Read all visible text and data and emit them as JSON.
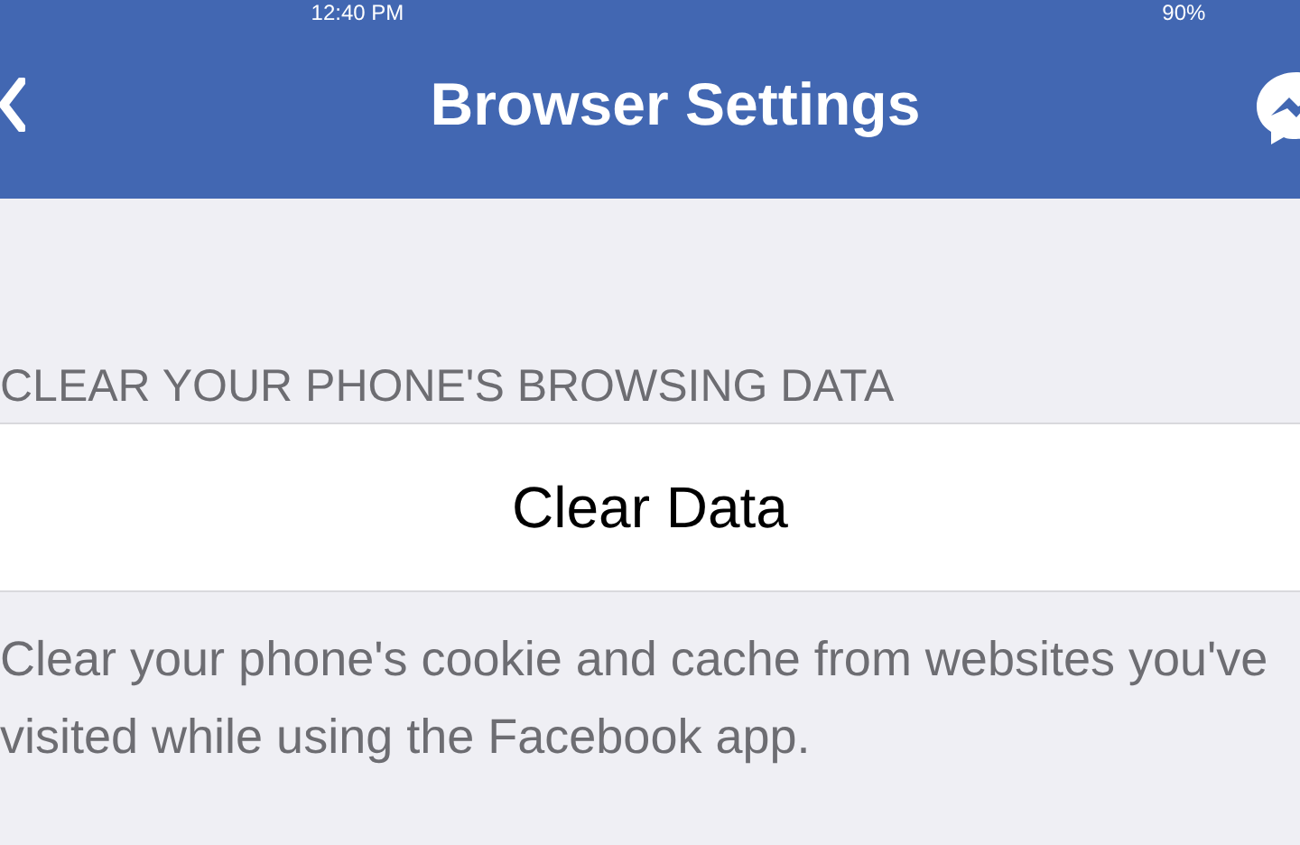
{
  "status_bar": {
    "time": "12:40 PM",
    "battery": "90%"
  },
  "nav_bar": {
    "title": "Browser Settings"
  },
  "section": {
    "header": "CLEAR YOUR PHONE'S BROWSING DATA",
    "button": "Clear Data",
    "footer": "Clear your phone's cookie and cache from websites you've visited while using the Facebook app."
  }
}
